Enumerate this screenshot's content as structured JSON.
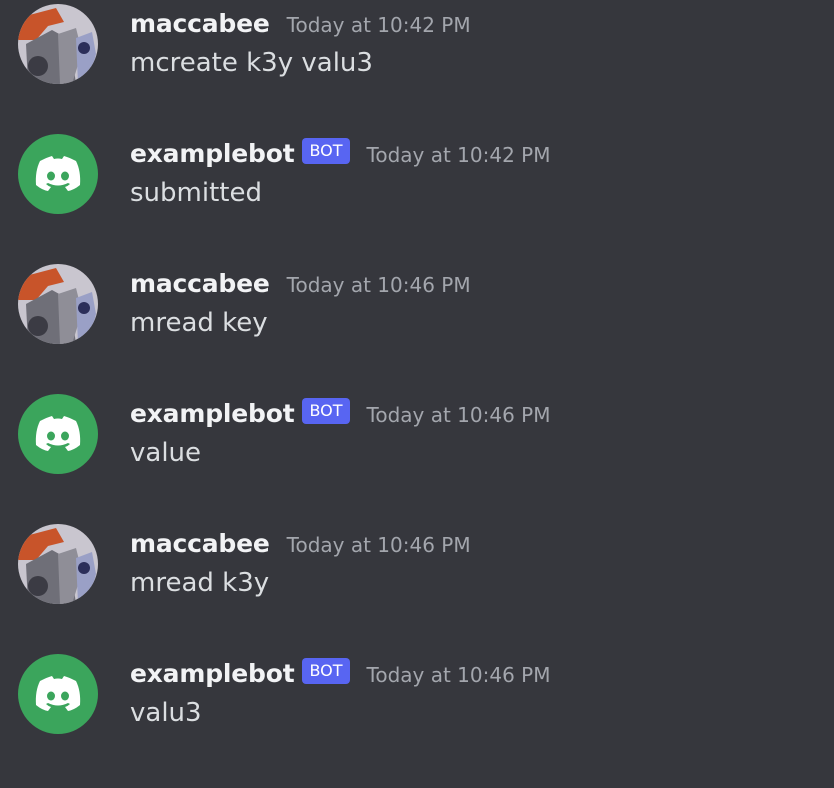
{
  "messages": [
    {
      "author": "maccabee",
      "is_bot": false,
      "timestamp": "Today at 10:42 PM",
      "content": "mcreate k3y valu3"
    },
    {
      "author": "examplebot",
      "is_bot": true,
      "bot_tag": "BOT",
      "timestamp": "Today at 10:42 PM",
      "content": "submitted"
    },
    {
      "author": "maccabee",
      "is_bot": false,
      "timestamp": "Today at 10:46 PM",
      "content": "mread key"
    },
    {
      "author": "examplebot",
      "is_bot": true,
      "bot_tag": "BOT",
      "timestamp": "Today at 10:46 PM",
      "content": "value"
    },
    {
      "author": "maccabee",
      "is_bot": false,
      "timestamp": "Today at 10:46 PM",
      "content": "mread k3y"
    },
    {
      "author": "examplebot",
      "is_bot": true,
      "bot_tag": "BOT",
      "timestamp": "Today at 10:46 PM",
      "content": "valu3"
    }
  ],
  "icons": {
    "user_avatar": "user-avatar-icon",
    "bot_avatar": "discord-logo-icon"
  },
  "colors": {
    "background": "#36373d",
    "bot_avatar_bg": "#3ba55c",
    "bot_tag_bg": "#5865f2",
    "username": "#f2f3f5",
    "timestamp": "#a3a6ad",
    "content": "#dbdee1"
  }
}
